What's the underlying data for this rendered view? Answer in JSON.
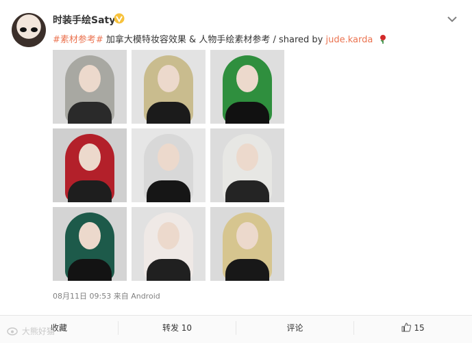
{
  "post": {
    "username": "时装手绘Saty",
    "hashtag": "#素材参考#",
    "text_main": " 加拿大模特妆容效果 & 人物手绘素材参考 / shared by ",
    "author_link": "jude.karda",
    "timestamp": "08月11日 09:53",
    "source_prefix": "来自",
    "source": "Android"
  },
  "actions": {
    "favorite": "收藏",
    "repost": "转发 10",
    "comment": "评论",
    "like_count": "15"
  },
  "watermark": "大熊好猫",
  "images": [
    {
      "name": "photo-1",
      "bg": "#d9d9d9",
      "hair": "#a8a8a2",
      "body": "#2a2a2a"
    },
    {
      "name": "photo-2",
      "bg": "#e3e3e3",
      "hair": "#c9bc8e",
      "body": "#1b1b1b"
    },
    {
      "name": "photo-3",
      "bg": "#dedede",
      "hair": "#2f8f3e",
      "body": "#111111"
    },
    {
      "name": "photo-4",
      "bg": "#cfcfcf",
      "hair": "#b3202a",
      "body": "#1e1e1e"
    },
    {
      "name": "photo-5",
      "bg": "#e6e6e6",
      "hair": "#d8d8d8",
      "body": "#161616"
    },
    {
      "name": "photo-6",
      "bg": "#dcdcdc",
      "hair": "#e7e7e4",
      "body": "#242424"
    },
    {
      "name": "photo-7",
      "bg": "#d4d4d4",
      "hair": "#1d5a4a",
      "body": "#131313"
    },
    {
      "name": "photo-8",
      "bg": "#e1e1e1",
      "hair": "#efe9e6",
      "body": "#202020"
    },
    {
      "name": "photo-9",
      "bg": "#dadada",
      "hair": "#d6c58f",
      "body": "#181818"
    }
  ]
}
